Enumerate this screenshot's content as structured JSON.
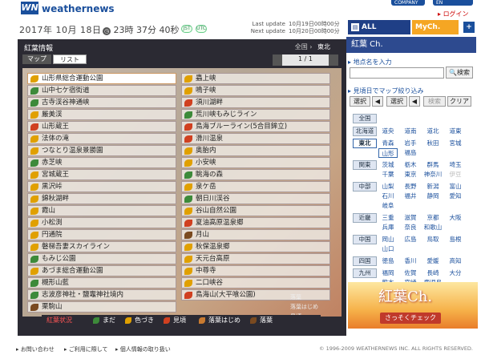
{
  "header": {
    "logo_mark": "WN",
    "logo_text": "weathernews",
    "top_link_1": "COMPANY",
    "top_link_2": "EN",
    "login": "ログイン"
  },
  "datebar": {
    "date": "2017年 10月 18日",
    "time": "23時 37分 40秒",
    "tz1": "JST",
    "tz2": "UTC",
    "last_update_label": "Last update",
    "last_update_value": "10月19日00時00分",
    "next_update_label": "Next update",
    "next_update_value": "10月20日00時00分"
  },
  "channel_tabs": {
    "all": "ALL Channel",
    "my": "MyCh.",
    "my_icon": "+"
  },
  "panel": {
    "title": "紅葉情報",
    "region_all": "全国",
    "region_current": "東北",
    "tab_map": "マップ",
    "tab_list": "リスト",
    "pager": "1 / 1"
  },
  "spots": [
    {
      "name": "山形県総合運動公園",
      "status": "orange"
    },
    {
      "name": "山中七ケ宿街道",
      "status": "green"
    },
    {
      "name": "古寺渓谷神通峡",
      "status": "green"
    },
    {
      "name": "厳美渓",
      "status": "orange"
    },
    {
      "name": "山形蔵王",
      "status": "red"
    },
    {
      "name": "法体の滝",
      "status": "orange"
    },
    {
      "name": "つなとり温泉景勝園",
      "status": "orange"
    },
    {
      "name": "赤芝峡",
      "status": "green"
    },
    {
      "name": "宮城蔵王",
      "status": "orange"
    },
    {
      "name": "黒沢峠",
      "status": "orange"
    },
    {
      "name": "錦秋湖畔",
      "status": "orange"
    },
    {
      "name": "霞山",
      "status": "orange"
    },
    {
      "name": "小松渕",
      "status": "orange"
    },
    {
      "name": "円通院",
      "status": "orange"
    },
    {
      "name": "磐梯吾妻スカイライン",
      "status": "orange"
    },
    {
      "name": "もみじ公園",
      "status": "green"
    },
    {
      "name": "あづま総合運動公園",
      "status": "orange"
    },
    {
      "name": "槻形山藍",
      "status": "green"
    },
    {
      "name": "志波彦神社・鹽竈神社境内",
      "status": "green"
    },
    {
      "name": "栗駒山",
      "status": "brown"
    },
    {
      "name": "蟲上峡",
      "status": "orange"
    },
    {
      "name": "鳴子峡",
      "status": "orange"
    },
    {
      "name": "須川湖畔",
      "status": "red"
    },
    {
      "name": "荒川峡もみじライン",
      "status": "green"
    },
    {
      "name": "鳥海ブルーライン(5合目鉾立)",
      "status": "red"
    },
    {
      "name": "滑川温泉",
      "status": "red"
    },
    {
      "name": "奥胎内",
      "status": "orange"
    },
    {
      "name": "小安峡",
      "status": "orange"
    },
    {
      "name": "眺海の森",
      "status": "green"
    },
    {
      "name": "泉ケ岳",
      "status": "orange"
    },
    {
      "name": "朝日川渓谷",
      "status": "green"
    },
    {
      "name": "谷山自然公園",
      "status": "orange"
    },
    {
      "name": "夏油高原温泉郷",
      "status": "red"
    },
    {
      "name": "月山",
      "status": "brown"
    },
    {
      "name": "秋保温泉郷",
      "status": "orange"
    },
    {
      "name": "天元台高原",
      "status": "orange"
    },
    {
      "name": "中尊寺",
      "status": "orange"
    },
    {
      "name": "二口峡谷",
      "status": "orange"
    },
    {
      "name": "鳥海山(大平喰公園)",
      "status": "red"
    }
  ],
  "legend": {
    "title": "紅葉状況",
    "items": [
      {
        "label": "まだ",
        "color": "#3d8a3a"
      },
      {
        "label": "色づき",
        "color": "#e0a000"
      },
      {
        "label": "見頃",
        "color": "#d04020"
      },
      {
        "label": "落葉はじめ",
        "color": "#c87a30"
      },
      {
        "label": "落葉",
        "color": "#7a4a20"
      }
    ],
    "side": [
      "落葉",
      "落葉はじめ",
      "見頃"
    ]
  },
  "sidebar": {
    "head": "紅葉 Ch.",
    "search_section": "地点名を入力",
    "search_button": "検索",
    "filter_section": "見頃日でマップ絞り込み",
    "select1": "選択",
    "select2": "選択",
    "search2": "検索",
    "clear": "クリア",
    "all_japan": "全国",
    "regions": [
      {
        "name": "北海道",
        "prefs": [
          "道央",
          "道南",
          "道北",
          "道東"
        ]
      },
      {
        "name": "東北",
        "prefs": [
          "青森",
          "岩手",
          "秋田",
          "宮城",
          "山形",
          "福島"
        ]
      },
      {
        "name": "関東",
        "prefs": [
          "茨城",
          "栃木",
          "群馬",
          "埼玉",
          "千葉",
          "東京",
          "神奈川",
          "伊豆"
        ]
      },
      {
        "name": "中部",
        "prefs": [
          "山梨",
          "長野",
          "新潟",
          "富山",
          "石川",
          "福井",
          "静岡",
          "愛知",
          "岐阜"
        ]
      },
      {
        "name": "近畿",
        "prefs": [
          "三重",
          "滋賀",
          "京都",
          "大阪",
          "兵庫",
          "奈良",
          "和歌山"
        ]
      },
      {
        "name": "中国",
        "prefs": [
          "岡山",
          "広島",
          "鳥取",
          "島根",
          "山口"
        ]
      },
      {
        "name": "四国",
        "prefs": [
          "徳島",
          "香川",
          "愛媛",
          "高知"
        ]
      },
      {
        "name": "九州",
        "prefs": [
          "福岡",
          "佐賀",
          "長崎",
          "大分",
          "熊本",
          "宮崎",
          "鹿児島"
        ]
      }
    ],
    "banner_title": "紅葉Ch.",
    "banner_sub": "さっそくチェック"
  },
  "footer": {
    "link1": "お問い合わせ",
    "link2": "ご利用に際して",
    "link3": "個人情報の取り扱い",
    "copyright": "© 1996-2009 WEATHERNEWS INC. ALL RIGHTS RESERVED."
  }
}
